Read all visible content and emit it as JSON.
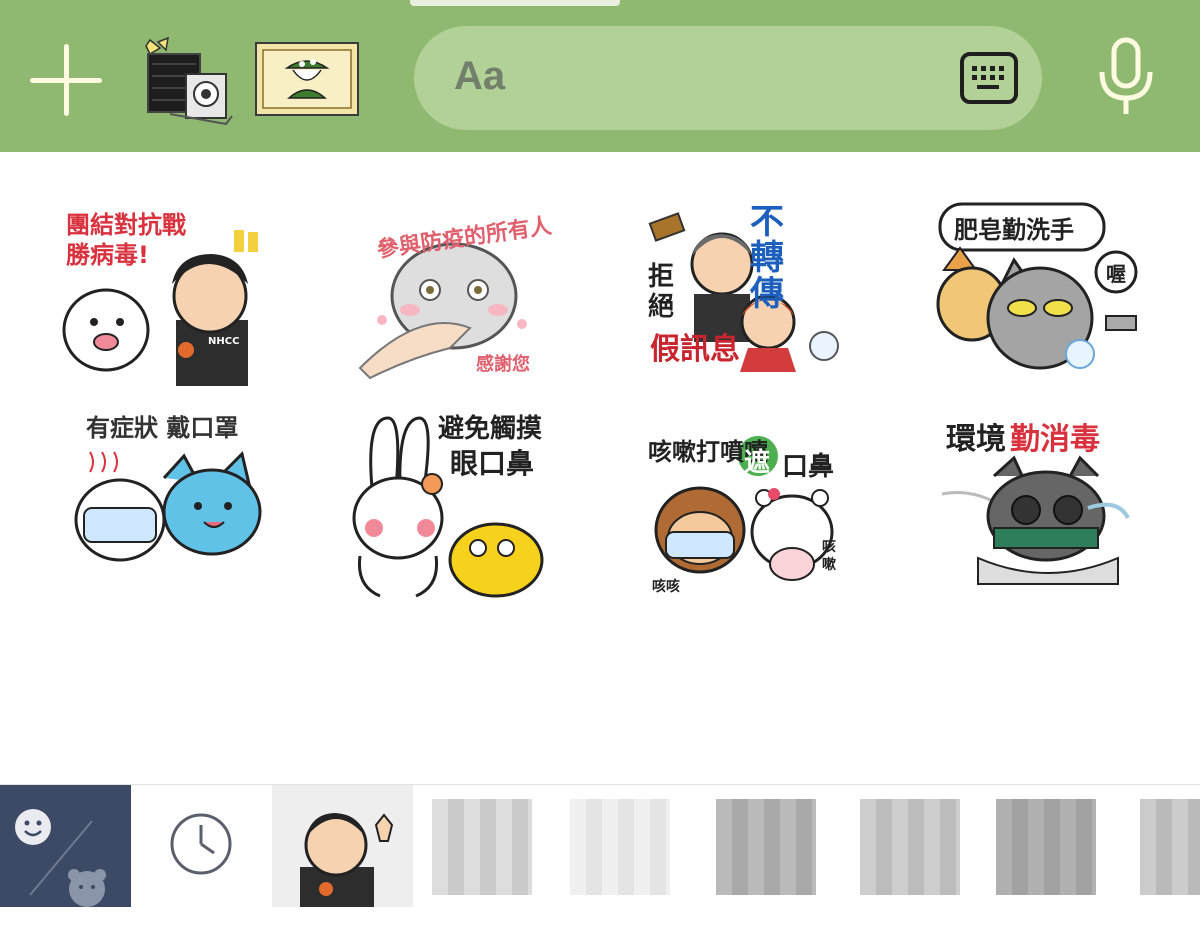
{
  "input": {
    "placeholder": "Aa"
  },
  "stickers": [
    {
      "label": "團結對抗戰勝病毒!"
    },
    {
      "label": "參與防疫的所有人",
      "label2": "感謝您"
    },
    {
      "label": "不轉傳",
      "label2": "拒絕",
      "label3": "假訊息"
    },
    {
      "label": "肥皂勤洗手",
      "label2": "喔"
    },
    {
      "label": "有症狀 戴口罩"
    },
    {
      "label": "避免觸摸",
      "label2": "眼口鼻"
    },
    {
      "label": "咳嗽打噴嚏",
      "label2": "遮",
      "label3": "口鼻",
      "label4": "咳咳",
      "label5": "咳嗽"
    },
    {
      "label": "環境",
      "label2": "勤消毒"
    }
  ],
  "sticker_badge": "NHCC",
  "colors": {
    "topbar": "#8fb871",
    "input": "#b2d197",
    "emoji_tab": "#3c4a66",
    "red_text": "#d9323f",
    "blue_text": "#1c5fbd"
  },
  "icons": [
    "plus-icon",
    "camera-icon",
    "photo-icon",
    "keyboard-icon",
    "microphone-icon",
    "emoji-icon",
    "bear-icon",
    "clock-icon"
  ]
}
